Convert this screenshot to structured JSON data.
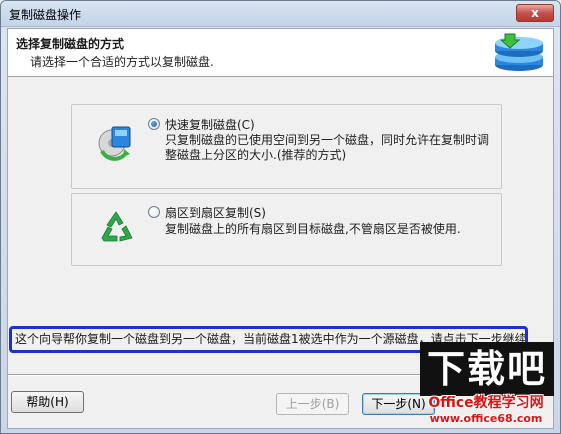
{
  "window": {
    "title": "复制磁盘操作",
    "close_label": "x"
  },
  "header": {
    "title": "选择复制磁盘的方式",
    "subtitle": "请选择一个合适的方式以复制磁盘."
  },
  "options": [
    {
      "label": "快速复制磁盘(C)",
      "description": "只复制磁盘的已使用空间到另一个磁盘，同时允许在复制时调整磁盘上分区的大小.(推荐的方式)",
      "checked": true,
      "icon": "disk-copy-icon"
    },
    {
      "label": "扇区到扇区复制(S)",
      "description": "复制磁盘上的所有扇区到目标磁盘,不管扇区是否被使用.",
      "checked": false,
      "icon": "recycle-icon"
    }
  ],
  "info_text": "这个向导帮你复制一个磁盘到另一个磁盘，当前磁盘1被选中作为一个源磁盘，请点击下一步继续.",
  "buttons": {
    "help": "帮助(H)",
    "back": "上一步(B)",
    "next": "下一步(N)"
  },
  "watermark": {
    "big": "下载吧",
    "mid": "Office教程学习网",
    "url": "www.office68.com"
  },
  "colors": {
    "info_border": "#1f2fd6",
    "watermark_red": "#e01010"
  }
}
